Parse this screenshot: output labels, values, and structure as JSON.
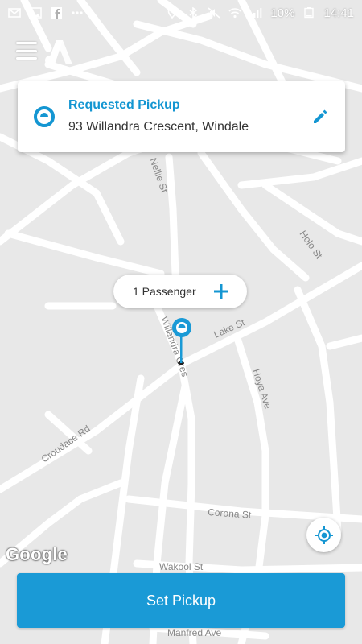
{
  "status_bar": {
    "battery": "10%",
    "time": "14:41",
    "left_icons": [
      "mail-icon",
      "image-icon",
      "facebook-icon",
      "more-icon"
    ],
    "right_icons": [
      "location-icon",
      "bluetooth-icon",
      "mute-icon",
      "wifi-icon",
      "signal-icon",
      "battery-icon"
    ]
  },
  "header": {
    "menu_icon": "menu-icon",
    "logo": "app-logo"
  },
  "pickup_card": {
    "title": "Requested Pickup",
    "address": "93 Willandra Crescent, Windale",
    "edit_icon": "pencil-icon",
    "title_color": "#1496d2"
  },
  "map": {
    "streets": [
      "Lake St",
      "Corona St",
      "Wakool St",
      "Manfred Ave",
      "Croudace Rd",
      "Willandra Cres",
      "Hoya Ave",
      "Holo St",
      "Nellie St"
    ],
    "attribution": "Google"
  },
  "passenger_selector": {
    "label": "1 Passenger",
    "add_icon": "plus-icon"
  },
  "locate_button": {
    "icon": "my-location-icon"
  },
  "primary_action": {
    "label": "Set Pickup",
    "color": "#1a9ad6"
  }
}
